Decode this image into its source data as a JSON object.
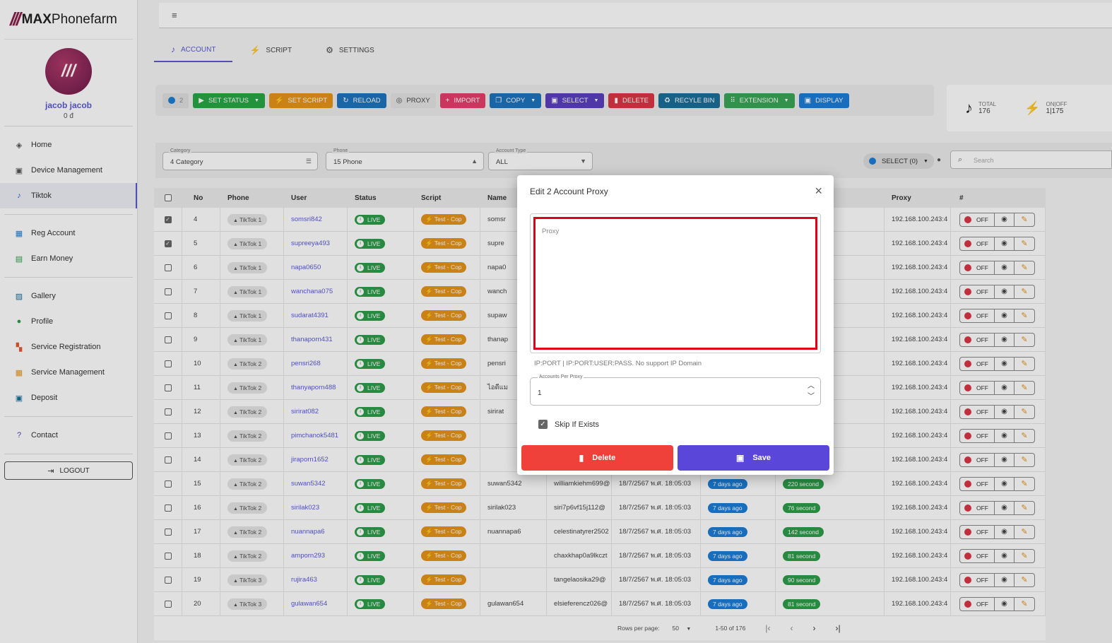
{
  "app": {
    "logo_mark": "///",
    "logo_text_bold": "MAX",
    "logo_text_rest": "Phonefarm",
    "avatar_mark": "///",
    "username": "jacob jacob",
    "balance": "0 đ"
  },
  "sidebar": {
    "groups": [
      [
        {
          "label": "Home",
          "icon": "layers-icon",
          "glyph": "◈",
          "color": "#555"
        },
        {
          "label": "Device Management",
          "icon": "devices-icon",
          "glyph": "▣",
          "color": "#555"
        },
        {
          "label": "Tiktok",
          "icon": "tiktok-icon",
          "glyph": "♪",
          "color": "#2b5bd6",
          "active": true
        }
      ],
      [
        {
          "label": "Reg Account",
          "icon": "grid-icon",
          "glyph": "▦",
          "color": "#1c7ed6"
        },
        {
          "label": "Earn Money",
          "icon": "money-icon",
          "glyph": "▤",
          "color": "#2e9e4a"
        }
      ],
      [
        {
          "label": "Gallery",
          "icon": "gallery-icon",
          "glyph": "▨",
          "color": "#1b6f9a"
        },
        {
          "label": "Profile",
          "icon": "person-icon",
          "glyph": "●",
          "color": "#2e9e4a"
        },
        {
          "label": "Service Registration",
          "icon": "apps-icon",
          "glyph": "▚",
          "color": "#e65a2e"
        },
        {
          "label": "Service Management",
          "icon": "service-icon",
          "glyph": "▦",
          "color": "#e6941a"
        },
        {
          "label": "Deposit",
          "icon": "deposit-icon",
          "glyph": "▣",
          "color": "#1b6f9a"
        }
      ],
      [
        {
          "label": "Contact",
          "icon": "help-icon",
          "glyph": "?",
          "color": "#5a3fc0"
        }
      ]
    ],
    "logout": "LOGOUT"
  },
  "tabs": [
    {
      "label": "ACCOUNT",
      "icon": "tiktok-icon",
      "glyph": "♪",
      "active": true
    },
    {
      "label": "SCRIPT",
      "icon": "bolt-icon",
      "glyph": "⚡"
    },
    {
      "label": "SETTINGS",
      "icon": "gear-icon",
      "glyph": "⚙"
    }
  ],
  "toolbar": {
    "selected_count": "2",
    "buttons": [
      {
        "label": "SET STATUS",
        "icon": "play-icon",
        "glyph": "▶",
        "cls": "b-green",
        "caret": true
      },
      {
        "label": "SET SCRIPT",
        "icon": "bolt-icon",
        "glyph": "⚡",
        "cls": "b-orange"
      },
      {
        "label": "RELOAD",
        "icon": "reload-icon",
        "glyph": "↻",
        "cls": "b-blue"
      },
      {
        "label": "PROXY",
        "icon": "proxy-icon",
        "glyph": "◎",
        "cls": "b-light"
      },
      {
        "label": "IMPORT",
        "icon": "plus-icon",
        "glyph": "+",
        "cls": "b-pink"
      },
      {
        "label": "COPY",
        "icon": "copy-icon",
        "glyph": "❐",
        "cls": "b-blue",
        "caret": true
      },
      {
        "label": "SELECT",
        "icon": "select-icon",
        "glyph": "▣",
        "cls": "b-purple",
        "caret": true
      },
      {
        "label": "DELETE",
        "icon": "trash-icon",
        "glyph": "▮",
        "cls": "b-red"
      },
      {
        "label": "RECYLE BIN",
        "icon": "recycle-icon",
        "glyph": "♻",
        "cls": "b-teal"
      },
      {
        "label": "EXTENSION",
        "icon": "extension-icon",
        "glyph": "⠿",
        "cls": "b-green2",
        "caret": true
      },
      {
        "label": "DISPLAY",
        "icon": "display-icon",
        "glyph": "▣",
        "cls": "b-blue2"
      }
    ]
  },
  "stats": {
    "total_label": "TOTAL",
    "total_value": "176",
    "onoff_label": "ON|OFF",
    "onoff_value": "1|175"
  },
  "filters": {
    "category_label": "Category",
    "category_value": "4 Category",
    "phone_label": "Phone",
    "phone_value": "15 Phone",
    "type_label": "Account Type",
    "type_value": "ALL",
    "select_label": "SELECT (0)",
    "search_placeholder": "Search"
  },
  "table": {
    "headers": [
      "No",
      "Phone",
      "User",
      "Status",
      "Script",
      "Name",
      "",
      "",
      "",
      "",
      "Proxy",
      "#"
    ],
    "rows": [
      {
        "checked": true,
        "no": "4",
        "phone": "TikTok 1",
        "user": "somsri842",
        "status": "LIVE",
        "script": "Test - Cop",
        "name": "somsr",
        "email": "",
        "date": "",
        "days": "",
        "secs": "",
        "proxy": "192.168.100.243:4",
        "toggle": "OFF"
      },
      {
        "checked": true,
        "no": "5",
        "phone": "TikTok 1",
        "user": "supreeya493",
        "status": "LIVE",
        "script": "Test - Cop",
        "name": "supre",
        "email": "",
        "date": "",
        "days": "",
        "secs": "",
        "proxy": "192.168.100.243:4",
        "toggle": "OFF"
      },
      {
        "checked": false,
        "no": "6",
        "phone": "TikTok 1",
        "user": "napa0650",
        "status": "LIVE",
        "script": "Test - Cop",
        "name": "napa0",
        "email": "",
        "date": "",
        "days": "",
        "secs": "",
        "proxy": "192.168.100.243:4",
        "toggle": "OFF"
      },
      {
        "checked": false,
        "no": "7",
        "phone": "TikTok 1",
        "user": "wanchana075",
        "status": "LIVE",
        "script": "Test - Cop",
        "name": "wanch",
        "email": "",
        "date": "",
        "days": "",
        "secs": "",
        "proxy": "192.168.100.243:4",
        "toggle": "OFF"
      },
      {
        "checked": false,
        "no": "8",
        "phone": "TikTok 1",
        "user": "sudarat4391",
        "status": "LIVE",
        "script": "Test - Cop",
        "name": "supaw",
        "email": "",
        "date": "",
        "days": "",
        "secs": "",
        "proxy": "192.168.100.243:4",
        "toggle": "OFF"
      },
      {
        "checked": false,
        "no": "9",
        "phone": "TikTok 1",
        "user": "thanaporn431",
        "status": "LIVE",
        "script": "Test - Cop",
        "name": "thanap",
        "email": "",
        "date": "",
        "days": "",
        "secs": "",
        "proxy": "192.168.100.243:4",
        "toggle": "OFF"
      },
      {
        "checked": false,
        "no": "10",
        "phone": "TikTok 2",
        "user": "pensri268",
        "status": "LIVE",
        "script": "Test - Cop",
        "name": "pensri",
        "email": "",
        "date": "",
        "days": "",
        "secs": "",
        "proxy": "192.168.100.243:4",
        "toggle": "OFF"
      },
      {
        "checked": false,
        "no": "11",
        "phone": "TikTok 2",
        "user": "thanyaporn488",
        "status": "LIVE",
        "script": "Test - Cop",
        "name": "ไอดีแม",
        "email": "",
        "date": "",
        "days": "",
        "secs": "",
        "proxy": "192.168.100.243:4",
        "toggle": "OFF"
      },
      {
        "checked": false,
        "no": "12",
        "phone": "TikTok 2",
        "user": "sirirat082",
        "status": "LIVE",
        "script": "Test - Cop",
        "name": "sirirat",
        "email": "",
        "date": "",
        "days": "",
        "secs": "",
        "proxy": "192.168.100.243:4",
        "toggle": "OFF"
      },
      {
        "checked": false,
        "no": "13",
        "phone": "TikTok 2",
        "user": "pimchanok5481",
        "status": "LIVE",
        "script": "Test - Cop",
        "name": "",
        "email": "",
        "date": "",
        "days": "",
        "secs": "",
        "proxy": "192.168.100.243:4",
        "toggle": "OFF"
      },
      {
        "checked": false,
        "no": "14",
        "phone": "TikTok 2",
        "user": "jiraporn1652",
        "status": "LIVE",
        "script": "Test - Cop",
        "name": "",
        "email": "",
        "date": "",
        "days": "",
        "secs": "",
        "proxy": "192.168.100.243:4",
        "toggle": "OFF"
      },
      {
        "checked": false,
        "no": "15",
        "phone": "TikTok 2",
        "user": "suwan5342",
        "status": "LIVE",
        "script": "Test - Cop",
        "name": "suwan5342",
        "email": "williamkiehm699@",
        "date": "18/7/2567 พ.ศ. 18:05:03",
        "days": "7 days ago",
        "secs": "220 second",
        "proxy": "192.168.100.243:4",
        "toggle": "OFF"
      },
      {
        "checked": false,
        "no": "16",
        "phone": "TikTok 2",
        "user": "sirilak023",
        "status": "LIVE",
        "script": "Test - Cop",
        "name": "sirilak023",
        "email": "siri7p6vf15j112@",
        "date": "18/7/2567 พ.ศ. 18:05:03",
        "days": "7 days ago",
        "secs": "76 second",
        "proxy": "192.168.100.243:4",
        "toggle": "OFF"
      },
      {
        "checked": false,
        "no": "17",
        "phone": "TikTok 2",
        "user": "nuannapa6",
        "status": "LIVE",
        "script": "Test - Cop",
        "name": "nuannapa6",
        "email": "celestinatyrer2502",
        "date": "18/7/2567 พ.ศ. 18:05:03",
        "days": "7 days ago",
        "secs": "142 second",
        "proxy": "192.168.100.243:4",
        "toggle": "OFF"
      },
      {
        "checked": false,
        "no": "18",
        "phone": "TikTok 2",
        "user": "amporn293",
        "status": "LIVE",
        "script": "Test - Cop",
        "name": "",
        "email": "chaxkhap0a9lkczt",
        "date": "18/7/2567 พ.ศ. 18:05:03",
        "days": "7 days ago",
        "secs": "81 second",
        "proxy": "192.168.100.243:4",
        "toggle": "OFF"
      },
      {
        "checked": false,
        "no": "19",
        "phone": "TikTok 3",
        "user": "rujira463",
        "status": "LIVE",
        "script": "Test - Cop",
        "name": "",
        "email": "tangelaosika29@",
        "date": "18/7/2567 พ.ศ. 18:05:03",
        "days": "7 days ago",
        "secs": "90 second",
        "proxy": "192.168.100.243:4",
        "toggle": "OFF"
      },
      {
        "checked": false,
        "no": "20",
        "phone": "TikTok 3",
        "user": "gulawan654",
        "status": "LIVE",
        "script": "Test - Cop",
        "name": "gulawan654",
        "email": "elsieferencz026@",
        "date": "18/7/2567 พ.ศ. 18:05:03",
        "days": "7 days ago",
        "secs": "81 second",
        "proxy": "192.168.100.243:4",
        "toggle": "OFF"
      }
    ]
  },
  "pager": {
    "rows_label": "Rows per page:",
    "rows_value": "50",
    "range": "1-50 of 176"
  },
  "modal": {
    "title": "Edit 2 Account Proxy",
    "proxy_placeholder": "Proxy",
    "hint": "IP:PORT | IP:PORT:USER:PASS. No support IP Domain",
    "per_proxy_label": "Accounts Per Proxy",
    "per_proxy_value": "1",
    "skip_label": "Skip If Exists",
    "delete_label": "Delete",
    "save_label": "Save"
  }
}
